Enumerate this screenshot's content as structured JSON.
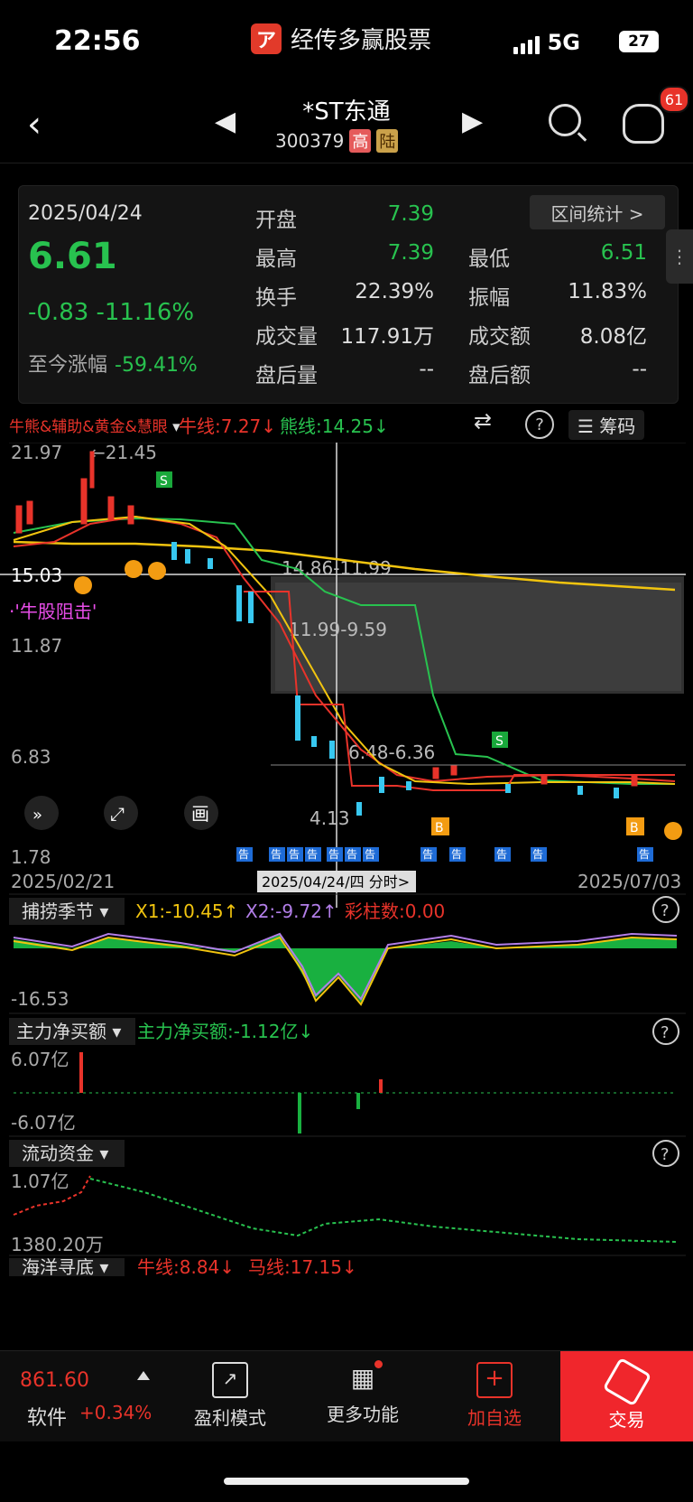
{
  "status": {
    "time": "22:56",
    "app_name": "经传多赢股票",
    "app_logo_char": "ア",
    "network": "5G",
    "battery": "27"
  },
  "nav": {
    "stock_name": "*ST东通",
    "stock_code": "300379",
    "tag_high": "高",
    "tag_lu": "陆",
    "badge": "61"
  },
  "quote": {
    "date": "2025/04/24",
    "price": "6.61",
    "change": "-0.83",
    "change_pct": "-11.16%",
    "ytd_label": "至今涨幅",
    "ytd_value": "-59.41%",
    "range_btn": "区间统计 >",
    "rows": [
      {
        "k1": "开盘",
        "v1": "7.39",
        "k2": "",
        "v2": ""
      },
      {
        "k1": "最高",
        "v1": "7.39",
        "k2": "最低",
        "v2": "6.51"
      },
      {
        "k1": "换手",
        "v1": "22.39%",
        "k2": "振幅",
        "v2": "11.83%"
      },
      {
        "k1": "成交量",
        "v1": "117.91万",
        "k2": "成交额",
        "v2": "8.08亿"
      },
      {
        "k1": "盘后量",
        "v1": "--",
        "k2": "盘后额",
        "v2": "--"
      }
    ]
  },
  "indicator": {
    "name": "牛熊&辅助&黄金&慧眼",
    "bull_line": "牛线:7.27↓",
    "bear_line": "熊线:14.25↓",
    "chip_label": "筹码"
  },
  "kchart": {
    "y_labels": [
      "21.97",
      "15.03",
      "11.87",
      "6.83",
      "1.78"
    ],
    "annotations": {
      "high": "21.45",
      "low": "4.13",
      "zone1": "14.86-11.99",
      "zone2": "11.99-9.59",
      "zone3": "6.48-6.36",
      "resist": "·'牛股阻击'"
    },
    "date_start": "2025/02/21",
    "date_end": "2025/07/03",
    "cursor_label": "2025/04/24/四 分时>",
    "signal_s": "S",
    "signal_b": "B",
    "marker_gao": "告"
  },
  "panel1": {
    "name": "捕捞季节",
    "x1": "X1:-10.45↑",
    "x2": "X2:-9.72↑",
    "caizhu": "彩柱数:0.00",
    "low": "-16.53"
  },
  "panel2": {
    "name": "主力净买额",
    "value": "主力净买额:-1.12亿↓",
    "top": "6.07亿",
    "bottom": "-6.07亿"
  },
  "panel3": {
    "name": "流动资金",
    "top": "1.07亿",
    "bottom": "1380.20万"
  },
  "panel4": {
    "name": "海洋寻底",
    "bull": "牛线:8.84↓",
    "horse": "马线:17.15↓"
  },
  "tabbar": {
    "index_value": "861.60",
    "index_name": "软件",
    "index_change": "+0.34%",
    "tabs": [
      {
        "label": "盈利模式"
      },
      {
        "label": "更多功能"
      },
      {
        "label": "加自选"
      },
      {
        "label": "交易"
      }
    ]
  },
  "colors": {
    "green": "#28c24f",
    "red": "#e8332a",
    "yellow": "#f1c40f",
    "cyan": "#38c8f0"
  }
}
